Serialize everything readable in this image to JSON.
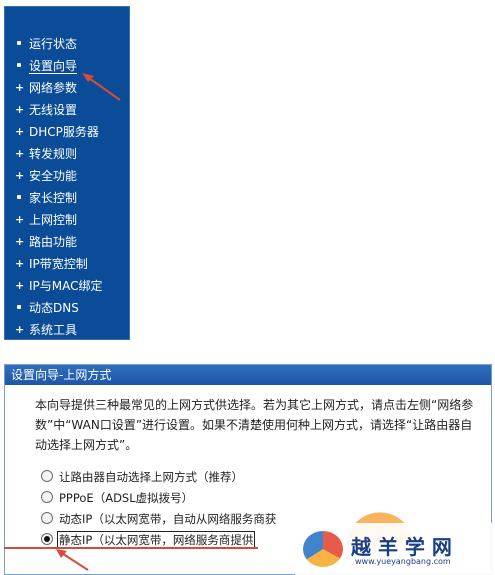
{
  "sidebar": {
    "items": [
      {
        "label": "运行状态",
        "marker": "bullet"
      },
      {
        "label": "设置向导",
        "marker": "bullet",
        "active": true
      },
      {
        "label": "网络参数",
        "marker": "plus"
      },
      {
        "label": "无线设置",
        "marker": "plus"
      },
      {
        "label": "DHCP服务器",
        "marker": "plus"
      },
      {
        "label": "转发规则",
        "marker": "plus"
      },
      {
        "label": "安全功能",
        "marker": "plus"
      },
      {
        "label": "家长控制",
        "marker": "bullet"
      },
      {
        "label": "上网控制",
        "marker": "plus"
      },
      {
        "label": "路由功能",
        "marker": "plus"
      },
      {
        "label": "IP带宽控制",
        "marker": "plus"
      },
      {
        "label": "IP与MAC绑定",
        "marker": "plus"
      },
      {
        "label": "动态DNS",
        "marker": "bullet"
      },
      {
        "label": "系统工具",
        "marker": "plus"
      }
    ]
  },
  "wizard": {
    "title": "设置向导-上网方式",
    "description": "本向导提供三种最常见的上网方式供选择。若为其它上网方式，请点击左侧“网络参数”中“WAN口设置”进行设置。如果不清楚使用何种上网方式，请选择“让路由器自动选择上网方式”。",
    "options": [
      {
        "label": "让路由器自动选择上网方式（推荐）",
        "checked": false
      },
      {
        "label": "PPPoE（ADSL虚拟拨号）",
        "checked": false
      },
      {
        "label": "动态IP（以太网宽带，自动从网络服务商获",
        "checked": false
      },
      {
        "label": "静态IP（以太网宽带，网络服务商提供",
        "checked": true
      }
    ]
  },
  "watermark": {
    "name": "越 羊 学 网",
    "url": "www.yueyangbang.com"
  },
  "colors": {
    "sidebar_bg": "#0a4c98",
    "title_bar": "#1d56a4",
    "annotation": "#d84a3a"
  }
}
